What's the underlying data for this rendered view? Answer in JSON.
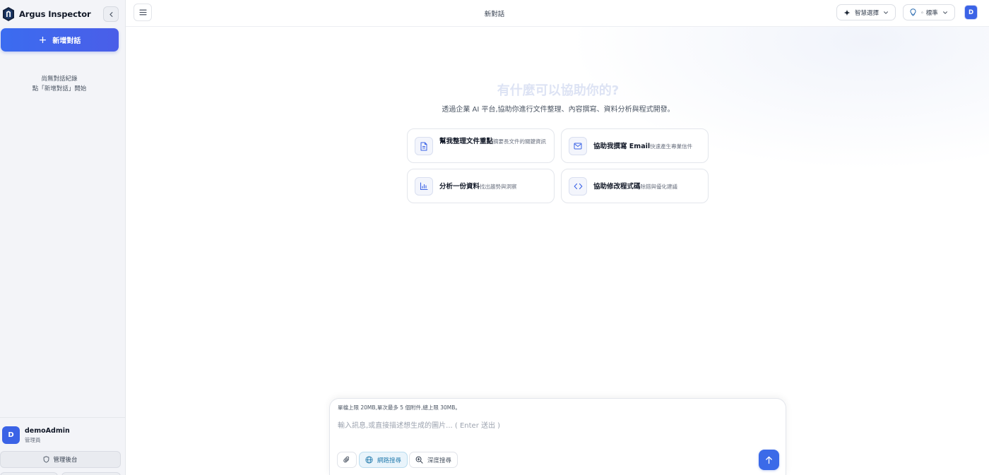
{
  "app": {
    "name": "Argus Inspector"
  },
  "sidebar": {
    "new_chat_label": "新增對話",
    "empty_line1": "尚無對話紀錄",
    "empty_line2": "點「新增對話」開始",
    "user": {
      "initial": "D",
      "name": "demoAdmin",
      "role": "管理員"
    },
    "admin_button_label": "管理後台"
  },
  "header": {
    "title": "新對話",
    "model_select_label": "智慧選擇",
    "mode_select_label": "◦ 標準",
    "avatar_initial": "D"
  },
  "main": {
    "hero_title": "有什麼可以協助你的?",
    "hero_subtitle": "透過企業 AI 平台,協助你進行文件整理、內容撰寫、資料分析與程式開發。",
    "suggestions": [
      {
        "title": "幫我整理文件重點",
        "desc": "摘要長文件的關鍵資訊",
        "icon": "document-icon"
      },
      {
        "title": "協助我撰寫 Email",
        "desc": "快速產生專業信件",
        "icon": "mail-icon"
      },
      {
        "title": "分析一份資料",
        "desc": "找出趨勢與洞察",
        "icon": "chart-icon"
      },
      {
        "title": "協助修改程式碼",
        "desc": "除錯與優化建議",
        "icon": "code-icon"
      }
    ]
  },
  "composer": {
    "limit_note": "單檔上限 20MB,單次最多 5 個附件,總上限 30MB。",
    "placeholder": "輸入訊息,或直接描述想生成的圖片... ( Enter 送出 )",
    "web_search_label": "網路搜尋",
    "deep_search_label": "深度搜尋"
  },
  "colors": {
    "accent": "#3b6ae8",
    "sidebar_bg": "#f3f4f8",
    "web_search_active": "#2a7fb0"
  }
}
